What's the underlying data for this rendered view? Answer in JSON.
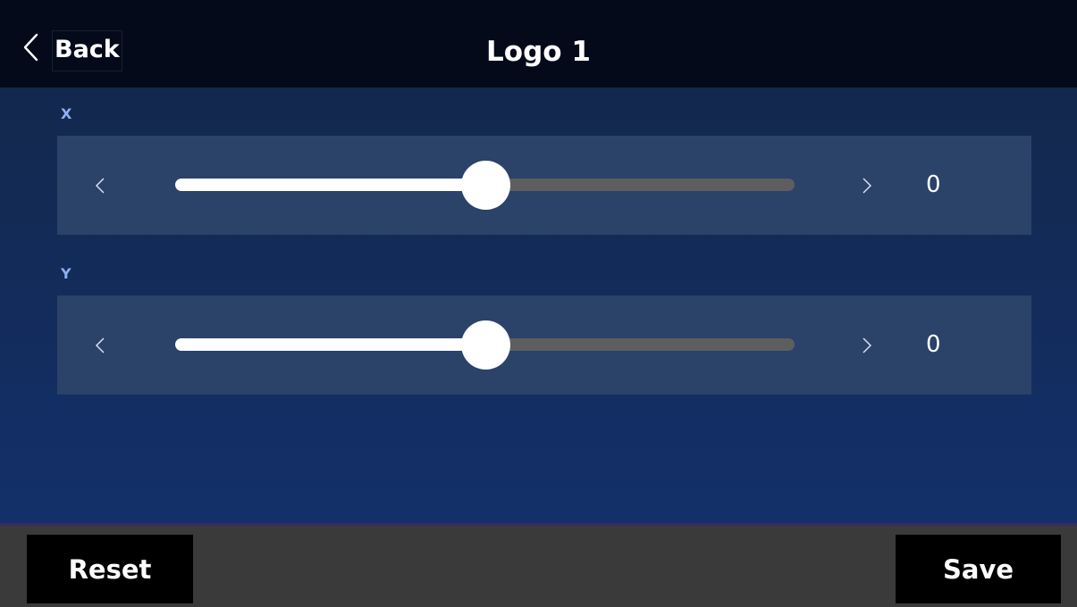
{
  "header": {
    "back_label": "Back",
    "back_icon": "chevron-left-icon",
    "title": "Logo 1"
  },
  "sliders": [
    {
      "label": "X",
      "value": "0",
      "position_fraction": 0.5,
      "decrement_icon": "chevron-left-icon",
      "increment_icon": "chevron-right-icon"
    },
    {
      "label": "Y",
      "value": "0",
      "position_fraction": 0.5,
      "decrement_icon": "chevron-left-icon",
      "increment_icon": "chevron-right-icon"
    }
  ],
  "footer": {
    "reset_label": "Reset",
    "save_label": "Save"
  },
  "colors": {
    "header_bg": "#040a1a",
    "panel_bg": "#2b4269",
    "label_accent": "#8fb0f0",
    "track_empty": "#5e5e5e",
    "track_fill": "#ffffff"
  }
}
